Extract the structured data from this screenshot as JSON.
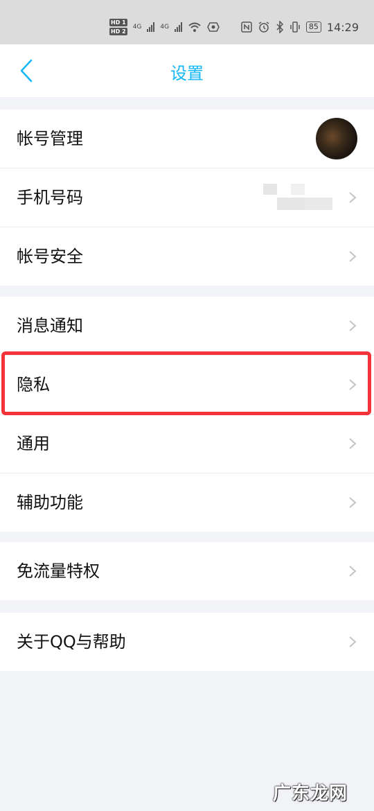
{
  "status_bar": {
    "hd1": "HD 1",
    "hd2": "HD 2",
    "net1": "4G",
    "net2": "4G",
    "battery": "85",
    "time": "14:29"
  },
  "nav": {
    "title": "设置",
    "back_icon": "chevron-left-icon",
    "accent_color": "#12b7f5"
  },
  "groups": [
    {
      "items": [
        {
          "label": "帐号管理",
          "trailing": "avatar"
        },
        {
          "label": "手机号码",
          "trailing": "blurred-value"
        },
        {
          "label": "帐号安全",
          "trailing": "chevron"
        }
      ]
    },
    {
      "items": [
        {
          "label": "消息通知",
          "trailing": "chevron"
        },
        {
          "label": "隐私",
          "trailing": "chevron",
          "highlighted": true
        },
        {
          "label": "通用",
          "trailing": "chevron"
        },
        {
          "label": "辅助功能",
          "trailing": "chevron"
        }
      ]
    },
    {
      "items": [
        {
          "label": "免流量特权",
          "trailing": "chevron"
        }
      ]
    },
    {
      "items": [
        {
          "label": "关于QQ与帮助",
          "trailing": "chevron"
        }
      ]
    }
  ],
  "highlight_color": "#f2333a",
  "watermark": "广东龙网"
}
